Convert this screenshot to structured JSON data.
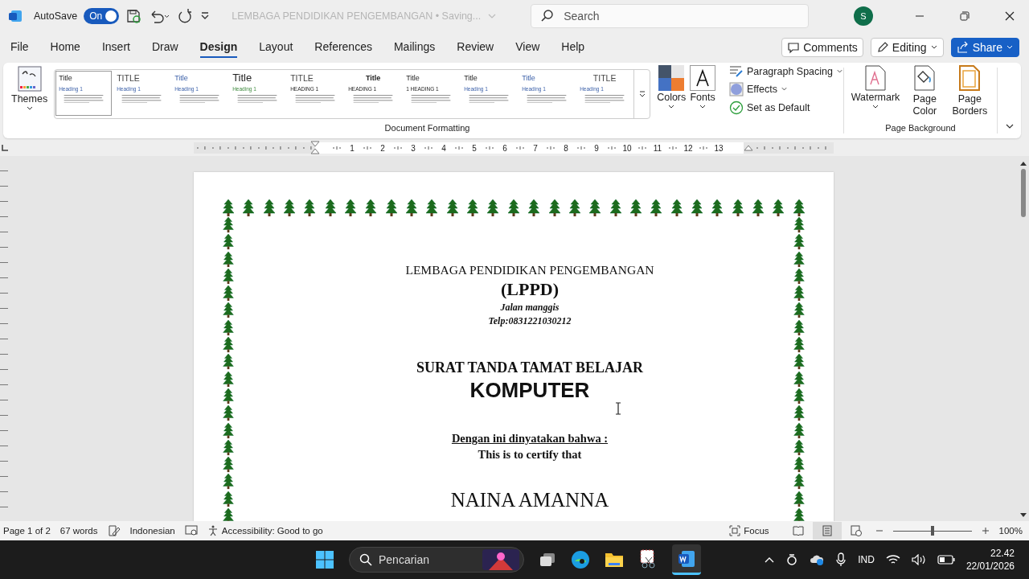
{
  "title_bar": {
    "autosave_label": "AutoSave",
    "autosave_toggle": {
      "label": "On",
      "on": true
    },
    "document_title": "LEMBAGA PENDIDIKAN PENGEMBANGAN • Saving...",
    "search": {
      "placeholder": "Search"
    },
    "avatar": "S"
  },
  "menu_tabs": [
    {
      "label": "File",
      "selected": false
    },
    {
      "label": "Home",
      "selected": false
    },
    {
      "label": "Insert",
      "selected": false
    },
    {
      "label": "Draw",
      "selected": false
    },
    {
      "label": "Design",
      "selected": true
    },
    {
      "label": "Layout",
      "selected": false
    },
    {
      "label": "References",
      "selected": false
    },
    {
      "label": "Mailings",
      "selected": false
    },
    {
      "label": "Review",
      "selected": false
    },
    {
      "label": "View",
      "selected": false
    },
    {
      "label": "Help",
      "selected": false
    }
  ],
  "header_buttons": {
    "comments": "Comments",
    "editing": "Editing",
    "share": "Share"
  },
  "ribbon": {
    "themes": "Themes",
    "style_gallery": [
      {
        "title": "Title",
        "heading": "Heading 1",
        "selected": true
      },
      {
        "title": "TITLE",
        "heading": "Heading 1",
        "selected": false
      },
      {
        "title": "Title",
        "heading": "Heading 1",
        "selected": false
      },
      {
        "title": "Title",
        "heading": "Heading 1",
        "selected": false
      },
      {
        "title": "TITLE",
        "heading": "HEADING 1",
        "selected": false
      },
      {
        "title": "Title",
        "heading": "HEADING 1",
        "selected": false
      },
      {
        "title": "Title",
        "heading": "1 HEADING 1",
        "selected": false
      },
      {
        "title": "Title",
        "heading": "Heading 1",
        "selected": false
      },
      {
        "title": "Title",
        "heading": "Heading 1",
        "selected": false
      },
      {
        "title": "TITLE",
        "heading": "Heading 1",
        "selected": false
      }
    ],
    "colors": "Colors",
    "fonts": "Fonts",
    "paragraph_spacing": "Paragraph Spacing",
    "effects": "Effects",
    "set_as_default": "Set as Default",
    "group_document_formatting": "Document Formatting",
    "watermark": "Watermark",
    "page_color": "Page Color",
    "page_borders": "Page Borders",
    "group_page_background": "Page Background"
  },
  "ruler": [
    "1",
    "2",
    "3",
    "4",
    "5",
    "6",
    "7",
    "8",
    "9",
    "10",
    "11",
    "12",
    "13"
  ],
  "document": {
    "institution": "LEMBAGA PENDIDIKAN PENGEMBANGAN",
    "abbreviation": "(LPPD)",
    "address": "Jalan manggis",
    "phone": "Telp:0831221030212",
    "certificate_title": "SURAT TANDA TAMAT BELAJAR",
    "subject": "KOMPUTER",
    "statement": "Dengan ini dinyatakan bahwa :",
    "statement_english": "This is to certify that",
    "recipient": "NAINA AMANNA"
  },
  "status_bar": {
    "page": "Page 1 of 2",
    "words": "67 words",
    "language": "Indonesian",
    "accessibility": "Accessibility: Good to go",
    "focus": "Focus",
    "views": [
      {
        "kind": "read",
        "selected": false
      },
      {
        "kind": "print",
        "selected": true
      },
      {
        "kind": "web",
        "selected": false
      }
    ],
    "zoom": {
      "level": 0.5,
      "reading": "100%"
    }
  },
  "taskbar": {
    "search": {
      "placeholder": "Pencarian"
    },
    "language": "IND",
    "time": "22.42",
    "date": "22/01/2026"
  }
}
